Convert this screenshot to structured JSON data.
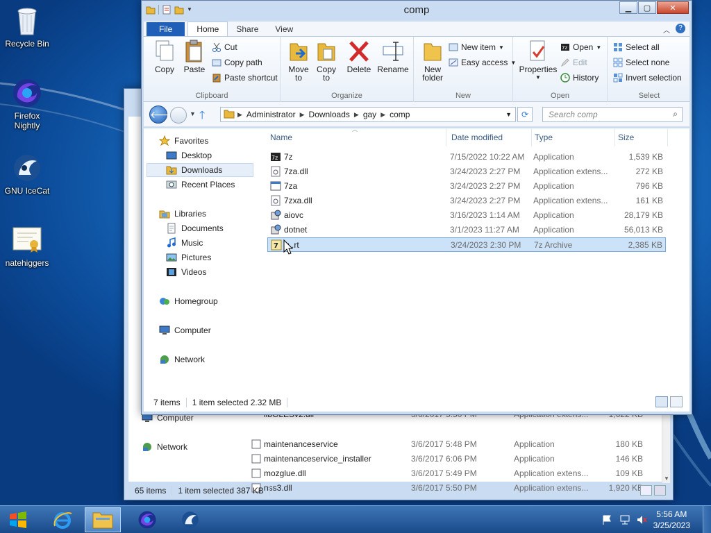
{
  "desktop": {
    "icons": [
      {
        "label": "Recycle Bin"
      },
      {
        "label": "Firefox Nightly"
      },
      {
        "label": "GNU IceCat"
      },
      {
        "label": "natehiggers"
      }
    ]
  },
  "back_window": {
    "nav": [
      {
        "label": "Computer"
      },
      {
        "label": "Network"
      }
    ],
    "rows": [
      {
        "name": "libGLESv2.dll",
        "date": "3/6/2017 5:50 PM",
        "type": "Application extens...",
        "size": "1,622 KB"
      },
      {
        "name": "maintenanceservice",
        "date": "3/6/2017 5:48 PM",
        "type": "Application",
        "size": "180 KB"
      },
      {
        "name": "maintenanceservice_installer",
        "date": "3/6/2017 6:06 PM",
        "type": "Application",
        "size": "146 KB"
      },
      {
        "name": "mozglue.dll",
        "date": "3/6/2017 5:49 PM",
        "type": "Application extens...",
        "size": "109 KB"
      },
      {
        "name": "nss3.dll",
        "date": "3/6/2017 5:50 PM",
        "type": "Application extens...",
        "size": "1,920 KB"
      }
    ],
    "status": {
      "count": "65 items",
      "selected": "1 item selected  387 KB"
    }
  },
  "window": {
    "title": "comp",
    "tabs": {
      "file": "File",
      "home": "Home",
      "share": "Share",
      "view": "View"
    },
    "ribbon": {
      "clipboard": {
        "label": "Clipboard",
        "copy": "Copy",
        "paste": "Paste",
        "cut": "Cut",
        "copy_path": "Copy path",
        "paste_shortcut": "Paste shortcut"
      },
      "organize": {
        "label": "Organize",
        "move_to": "Move",
        "move_to2": "to",
        "copy_to": "Copy",
        "copy_to2": "to",
        "delete": "Delete",
        "rename": "Rename"
      },
      "new": {
        "label": "New",
        "new_folder": "New",
        "new_folder2": "folder",
        "new_item": "New item",
        "easy_access": "Easy access"
      },
      "open": {
        "label": "Open",
        "properties": "Properties",
        "open": "Open",
        "edit": "Edit",
        "history": "History"
      },
      "select": {
        "label": "Select",
        "select_all": "Select all",
        "select_none": "Select none",
        "invert": "Invert selection"
      }
    },
    "address": {
      "crumbs": [
        "Administrator",
        "Downloads",
        "gay",
        "comp"
      ],
      "search_placeholder": "Search comp"
    },
    "nav": {
      "favorites": "Favorites",
      "desktop": "Desktop",
      "downloads": "Downloads",
      "recent": "Recent Places",
      "libraries": "Libraries",
      "documents": "Documents",
      "music": "Music",
      "pictures": "Pictures",
      "videos": "Videos",
      "homegroup": "Homegroup",
      "computer": "Computer",
      "network": "Network"
    },
    "columns": {
      "name": "Name",
      "date": "Date modified",
      "type": "Type",
      "size": "Size"
    },
    "files": [
      {
        "name": "7z",
        "date": "7/15/2022 10:22 AM",
        "type": "Application",
        "size": "1,539 KB",
        "icon": "7z-app-icon"
      },
      {
        "name": "7za.dll",
        "date": "3/24/2023 2:27 PM",
        "type": "Application extens...",
        "size": "272 KB",
        "icon": "dll-icon"
      },
      {
        "name": "7za",
        "date": "3/24/2023 2:27 PM",
        "type": "Application",
        "size": "796 KB",
        "icon": "app-icon"
      },
      {
        "name": "7zxa.dll",
        "date": "3/24/2023 2:27 PM",
        "type": "Application extens...",
        "size": "161 KB",
        "icon": "dll-icon"
      },
      {
        "name": "aiovc",
        "date": "3/16/2023 1:14 AM",
        "type": "Application",
        "size": "28,179 KB",
        "icon": "installer-icon"
      },
      {
        "name": "dotnet",
        "date": "3/1/2023 11:27 AM",
        "type": "Application",
        "size": "56,013 KB",
        "icon": "installer-icon"
      },
      {
        "name": "u..rt",
        "date": "3/24/2023 2:30 PM",
        "type": "7z Archive",
        "size": "2,385 KB",
        "icon": "7z-archive-icon"
      }
    ],
    "status": {
      "count": "7 items",
      "selected": "1 item selected  2.32 MB"
    }
  },
  "taskbar": {
    "clock_time": "5:56 AM",
    "clock_date": "3/25/2023"
  },
  "colors": {
    "accent": "#1f5fb7",
    "selection": "#cce2f8",
    "taskbar": "#194a8a"
  }
}
